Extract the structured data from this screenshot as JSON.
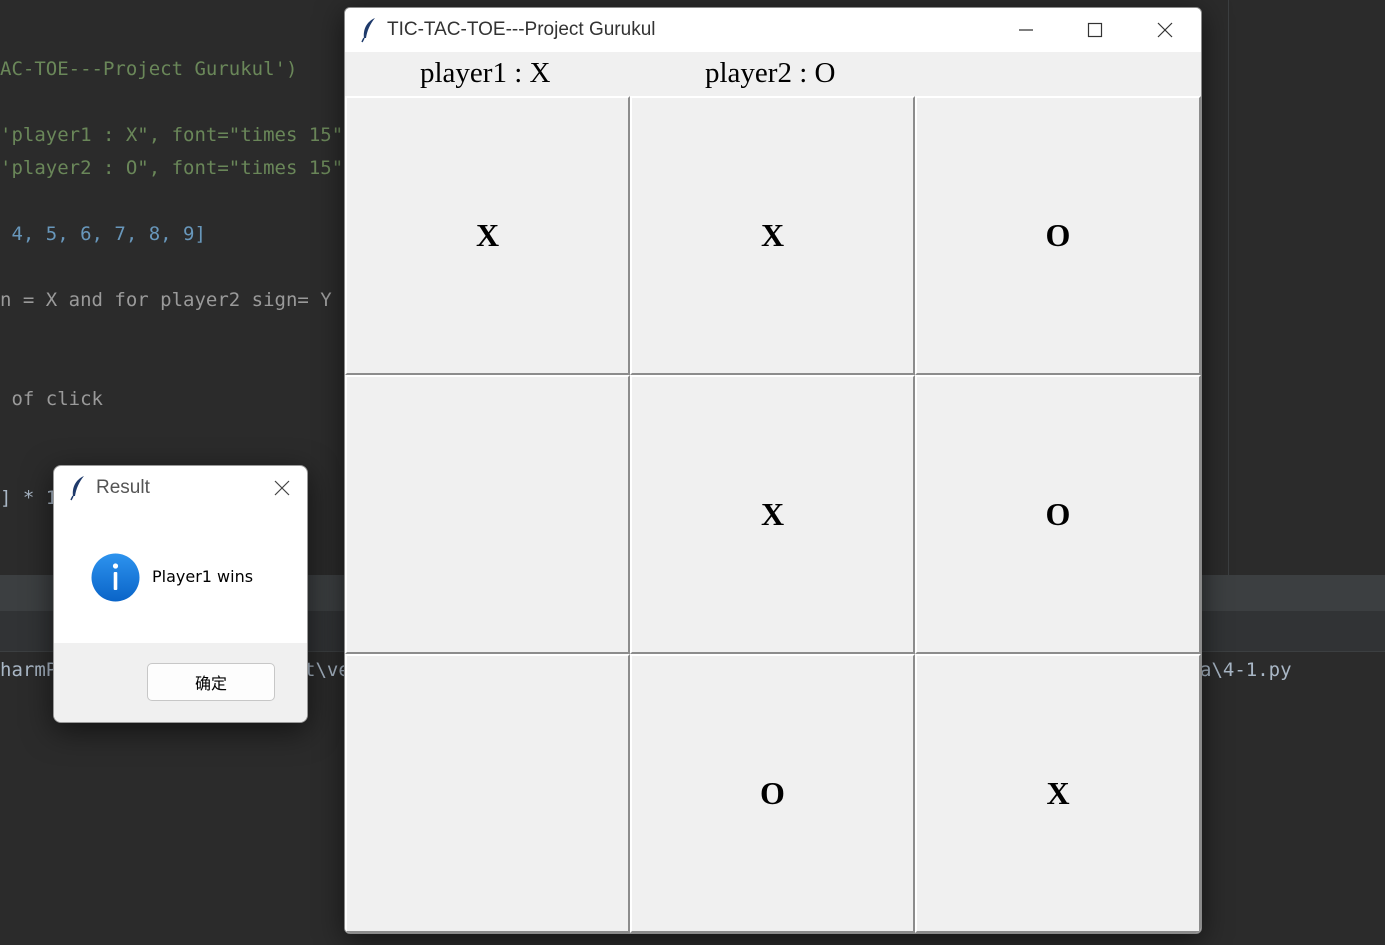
{
  "ide": {
    "code_lines": [
      {
        "text": "AC-TOE---Project Gurukul')"
      },
      {
        "text": "'player1 : X\", font=\"times 15\""
      },
      {
        "text": "'player2 : O\", font=\"times 15\""
      },
      {
        "text": " 4, 5, 6, 7, 8, 9]"
      },
      {
        "text": "n = X and for player2 sign= Y"
      },
      {
        "text": " of click"
      },
      {
        "text": "] * 1"
      }
    ],
    "run_left": "harmP",
    "run_mid": "t\\ve",
    "run_right": "a\\4-1.py"
  },
  "window": {
    "title": "TIC-TAC-TOE---Project Gurukul",
    "icon": "feather-icon",
    "controls": [
      "minimize-icon",
      "maximize-icon",
      "close-icon"
    ]
  },
  "players": {
    "player1": "player1 : X",
    "player2": "player2 : O"
  },
  "board": {
    "cells": [
      "X",
      "X",
      "O",
      "",
      "X",
      "O",
      "",
      "O",
      "X"
    ]
  },
  "dialog": {
    "title": "Result",
    "icon": "info-icon",
    "message": "Player1 wins",
    "ok_label": "确定",
    "accent": "#0a74da"
  }
}
